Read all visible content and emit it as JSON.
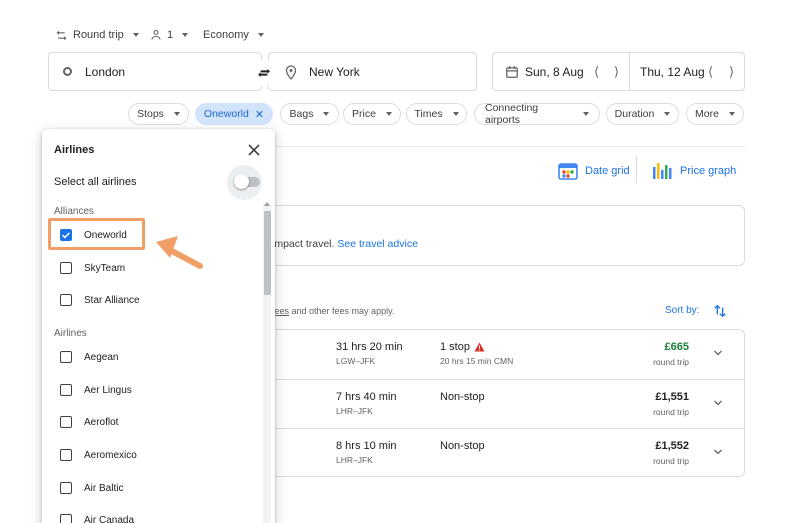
{
  "search": {
    "trip_type": "Round trip",
    "passengers": "1",
    "cabin": "Economy",
    "origin": "London",
    "destination": "New York",
    "depart_date": "Sun, 8 Aug",
    "return_date": "Thu, 12 Aug"
  },
  "filters": {
    "stops": "Stops",
    "airline_active": "Oneworld",
    "bags": "Bags",
    "price": "Price",
    "times": "Times",
    "connecting": "Connecting airports",
    "duration": "Duration",
    "more": "More"
  },
  "toolbar": {
    "date_grid": "Date grid",
    "price_graph": "Price graph"
  },
  "advisory": {
    "text": "impact travel. ",
    "link": "See travel advice"
  },
  "fees_note": {
    "link": "fees",
    "rest": " and other fees may apply."
  },
  "sort_label": "Sort by:",
  "results": [
    {
      "duration": "31 hrs 20 min",
      "route": "LGW–JFK",
      "stops": "1 stop",
      "stop_detail": "20 hrs 15 min CMN",
      "price": "£665",
      "price_type": "round trip",
      "warning": true,
      "cheap": true
    },
    {
      "duration": "7 hrs 40 min",
      "route": "LHR–JFK",
      "stops": "Non-stop",
      "stop_detail": "",
      "price": "£1,551",
      "price_type": "round trip",
      "warning": false,
      "cheap": false
    },
    {
      "duration": "8 hrs 10 min",
      "route": "LHR–JFK",
      "stops": "Non-stop",
      "stop_detail": "",
      "price": "£1,552",
      "price_type": "round trip",
      "warning": false,
      "cheap": false
    }
  ],
  "airline_panel": {
    "title": "Airlines",
    "select_all": "Select all airlines",
    "select_all_on": false,
    "alliances_heading": "Alliances",
    "alliances": [
      {
        "label": "Oneworld",
        "checked": true
      },
      {
        "label": "SkyTeam",
        "checked": false
      },
      {
        "label": "Star Alliance",
        "checked": false
      }
    ],
    "airlines_heading": "Airlines",
    "airlines": [
      {
        "label": "Aegean",
        "checked": false
      },
      {
        "label": "Aer Lingus",
        "checked": false
      },
      {
        "label": "Aeroflot",
        "checked": false
      },
      {
        "label": "Aeromexico",
        "checked": false
      },
      {
        "label": "Air Baltic",
        "checked": false
      },
      {
        "label": "Air Canada",
        "checked": false
      }
    ]
  },
  "colors": {
    "accent": "#1a73e8",
    "chip_active_bg": "#d2e3fc",
    "price_green": "#188038",
    "highlight": "#f0a066",
    "warning": "#d93025"
  }
}
